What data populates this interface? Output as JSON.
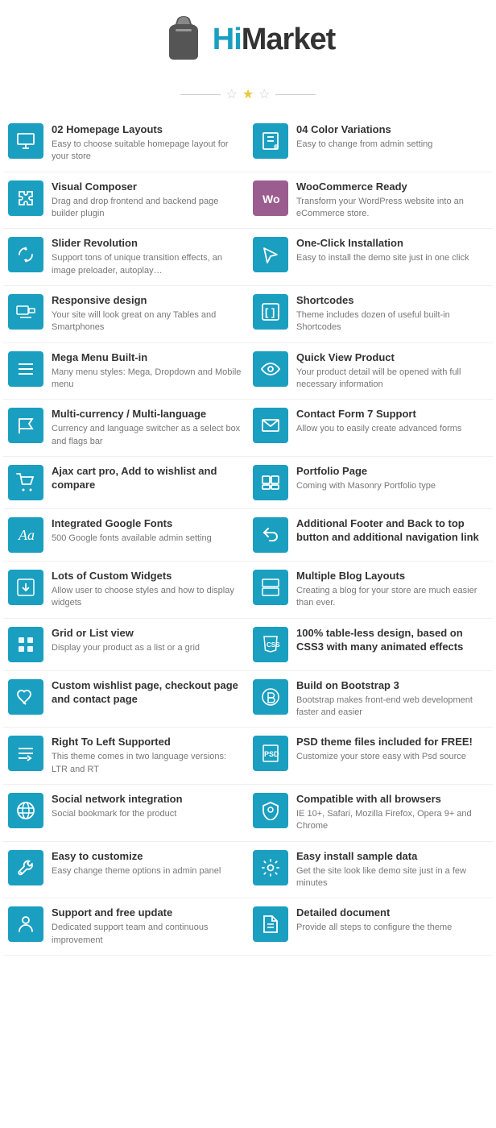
{
  "header": {
    "logo_hi": "Hi",
    "logo_market": "Market"
  },
  "features": [
    {
      "id": "homepage-layouts",
      "title": "02 Homepage Layouts",
      "desc": "Easy to choose suitable homepage layout for your store",
      "icon": "monitor",
      "col": 0
    },
    {
      "id": "color-variations",
      "title": "04 Color Variations",
      "desc": "Easy to change from  admin setting",
      "icon": "paint",
      "col": 1
    },
    {
      "id": "visual-composer",
      "title": "Visual Composer",
      "desc": "Drag and drop frontend and backend page builder plugin",
      "icon": "puzzle",
      "col": 0
    },
    {
      "id": "woocommerce",
      "title": "WooCommerce Ready",
      "desc": "Transform your WordPress website into an eCommerce store.",
      "icon": "woo",
      "col": 1
    },
    {
      "id": "slider-revolution",
      "title": "Slider Revolution",
      "desc": "Support tons of unique transition effects, an image preloader, autoplay…",
      "icon": "refresh",
      "col": 0
    },
    {
      "id": "one-click",
      "title": "One-Click Installation",
      "desc": "Easy to install the demo site just in one click",
      "icon": "cursor",
      "col": 1
    },
    {
      "id": "responsive",
      "title": "Responsive design",
      "desc": "Your site will look great on any Tables and Smartphones",
      "icon": "desktop",
      "col": 0
    },
    {
      "id": "shortcodes",
      "title": "Shortcodes",
      "desc": "Theme includes dozen of useful built-in Shortcodes",
      "icon": "brackets",
      "col": 1
    },
    {
      "id": "mega-menu",
      "title": "Mega Menu Built-in",
      "desc": "Many menu styles: Mega, Dropdown and Mobile menu",
      "icon": "menu",
      "col": 0
    },
    {
      "id": "quick-view",
      "title": "Quick View Product",
      "desc": "Your product detail will be opened with full necessary information",
      "icon": "eye",
      "col": 1
    },
    {
      "id": "multicurrency",
      "title": "Multi-currency / Multi-language",
      "desc": "Currency and language switcher as a select box and flags bar",
      "icon": "flag",
      "col": 0
    },
    {
      "id": "contact-form",
      "title": "Contact Form 7 Support",
      "desc": "Allow you to easily create advanced forms",
      "icon": "envelope",
      "col": 1
    },
    {
      "id": "ajax-cart",
      "title": "Ajax cart pro, Add to wishlist and compare",
      "desc": "",
      "icon": "cart",
      "col": 0
    },
    {
      "id": "portfolio",
      "title": "Portfolio Page",
      "desc": "Coming with Masonry Portfolio type",
      "icon": "portfolio",
      "col": 1
    },
    {
      "id": "google-fonts",
      "title": "Integrated Google Fonts",
      "desc": "500 Google fonts available admin setting",
      "icon": "font",
      "col": 0
    },
    {
      "id": "footer",
      "title": "Additional Footer and Back to top button and additional navigation link",
      "desc": "",
      "icon": "arrow-back",
      "col": 1
    },
    {
      "id": "custom-widgets",
      "title": "Lots of Custom Widgets",
      "desc": "Allow user to choose styles and how to display widgets",
      "icon": "download",
      "col": 0
    },
    {
      "id": "blog-layouts",
      "title": "Multiple Blog Layouts",
      "desc": "Creating a blog for your store are much easier than ever.",
      "icon": "blog",
      "col": 1
    },
    {
      "id": "grid-list",
      "title": "Grid or List view",
      "desc": "Display your product as a list or a grid",
      "icon": "grid",
      "col": 0
    },
    {
      "id": "css3",
      "title": "100% table-less design, based on CSS3 with many animated effects",
      "desc": "",
      "icon": "css3",
      "col": 1
    },
    {
      "id": "wishlist",
      "title": "Custom wishlist page, checkout page and contact page",
      "desc": "",
      "icon": "heart",
      "col": 0
    },
    {
      "id": "bootstrap",
      "title": "Build on Bootstrap 3",
      "desc": "Bootstrap makes front-end web development faster and easier",
      "icon": "bootstrap",
      "col": 1
    },
    {
      "id": "rtl",
      "title": "Right To Left Supported",
      "desc": "This theme comes in two language versions: LTR and RT",
      "icon": "rtl",
      "col": 0
    },
    {
      "id": "psd",
      "title": "PSD theme files included for FREE!",
      "desc": "Customize your store easy with Psd source",
      "icon": "psd",
      "col": 1
    },
    {
      "id": "social",
      "title": "Social network integration",
      "desc": "Social bookmark for the product",
      "icon": "globe",
      "col": 0
    },
    {
      "id": "browsers",
      "title": "Compatible with all browsers",
      "desc": "IE 10+, Safari, Mozilla Firefox, Opera 9+ and Chrome",
      "icon": "shield",
      "col": 1
    },
    {
      "id": "customize",
      "title": "Easy to customize",
      "desc": "Easy change theme options in admin panel",
      "icon": "wrench",
      "col": 0
    },
    {
      "id": "sample-data",
      "title": "Easy install sample data",
      "desc": "Get the site look like demo site just in a few minutes",
      "icon": "gear",
      "col": 1
    },
    {
      "id": "support",
      "title": "Support and  free update",
      "desc": "Dedicated support team and continuous improvement",
      "icon": "person",
      "col": 0
    },
    {
      "id": "document",
      "title": "Detailed document",
      "desc": "Provide all steps to configure the theme",
      "icon": "doc",
      "col": 1
    }
  ]
}
